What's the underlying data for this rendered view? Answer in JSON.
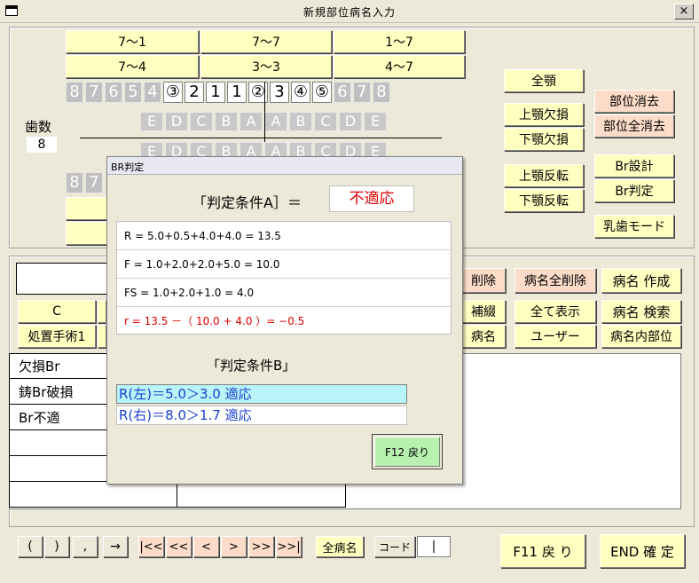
{
  "window": {
    "title": "新規部位病名入力",
    "close_label": "×"
  },
  "top_ranges": {
    "row1": [
      "7～1",
      "7～7",
      "1～7"
    ],
    "row2": [
      "7～4",
      "3～3",
      "4～7"
    ]
  },
  "teeth_upper": [
    "8",
    "7",
    "6",
    "5",
    "4",
    "③",
    "2",
    "1",
    "1",
    "②",
    "3",
    "④",
    "⑤",
    "6",
    "7",
    "8"
  ],
  "teeth_upper_on": [
    false,
    false,
    false,
    false,
    false,
    true,
    true,
    true,
    true,
    true,
    true,
    true,
    true,
    false,
    false,
    false
  ],
  "deciduous_upper": [
    "E",
    "D",
    "C",
    "B",
    "A",
    "A",
    "B",
    "C",
    "D",
    "E"
  ],
  "deciduous_lower": [
    "E",
    "D",
    "C",
    "B",
    "A",
    "A",
    "B",
    "C",
    "D",
    "E"
  ],
  "teeth_lower_partial": [
    "8",
    "7"
  ],
  "tooth_count": {
    "label": "歯数",
    "value": "8"
  },
  "right_buttons": {
    "all_jaw": "全顎",
    "upper_missing": "上顎欠損",
    "lower_missing": "下顎欠損",
    "upper_invert": "上顎反転",
    "lower_invert": "下顎反転",
    "site_delete": "部位消去",
    "site_delete_all": "部位全消去",
    "br_design": "Br設計",
    "br_judge": "Br判定",
    "primary_mode": "乳歯モード"
  },
  "mid_buttons": {
    "delete": "削除",
    "delete_all": "病名全削除",
    "create": "病名 作成",
    "supplement": "補綴",
    "show_all": "全て表示",
    "search": "病名 検索",
    "disease": "病名",
    "user": "ユーザー",
    "inner_site": "病名内部位",
    "c": "C",
    "treatment1": "処置手術1"
  },
  "disease_list": [
    "欠損Br",
    "鋳Br破損",
    "Br不適",
    "",
    "",
    ""
  ],
  "bottom": {
    "paren_open": "(",
    "paren_close": ")",
    "comma": ",",
    "arrow": "→",
    "nav": [
      "|<<",
      "<<",
      "<",
      ">",
      ">>",
      ">>|"
    ],
    "all_names": "全病名",
    "code_label": "コード",
    "code_value": "|",
    "f11": "F11 戻 り",
    "end": "END 確 定"
  },
  "dialog": {
    "title": "BR判定",
    "cond_a_label": "「判定条件A］＝",
    "cond_a_result": "不適応",
    "calc": [
      "R  = 5.0+0.5+4.0+4.0 = 13.5",
      "F  = 1.0+2.0+2.0+5.0 = 10.0",
      "FS  = 1.0+2.0+1.0 = 4.0",
      "r = 13.5 －（ 10.0 + 4.0 ）= −0.5"
    ],
    "cond_b_label": "「判定条件B」",
    "cond_b": [
      "R(左)＝5.0＞3.0  適応",
      "R(右)＝8.0＞1.7  適応"
    ],
    "f12": "F12 戻り"
  },
  "colors": {
    "yellow_button": "#ffffc0",
    "pink_button": "#fcdcc8",
    "result_red": "#e00000",
    "result_blue": "#1a3fd0",
    "highlight_cyan": "#b8f4f8",
    "f12_green": "#b8f0b0"
  }
}
